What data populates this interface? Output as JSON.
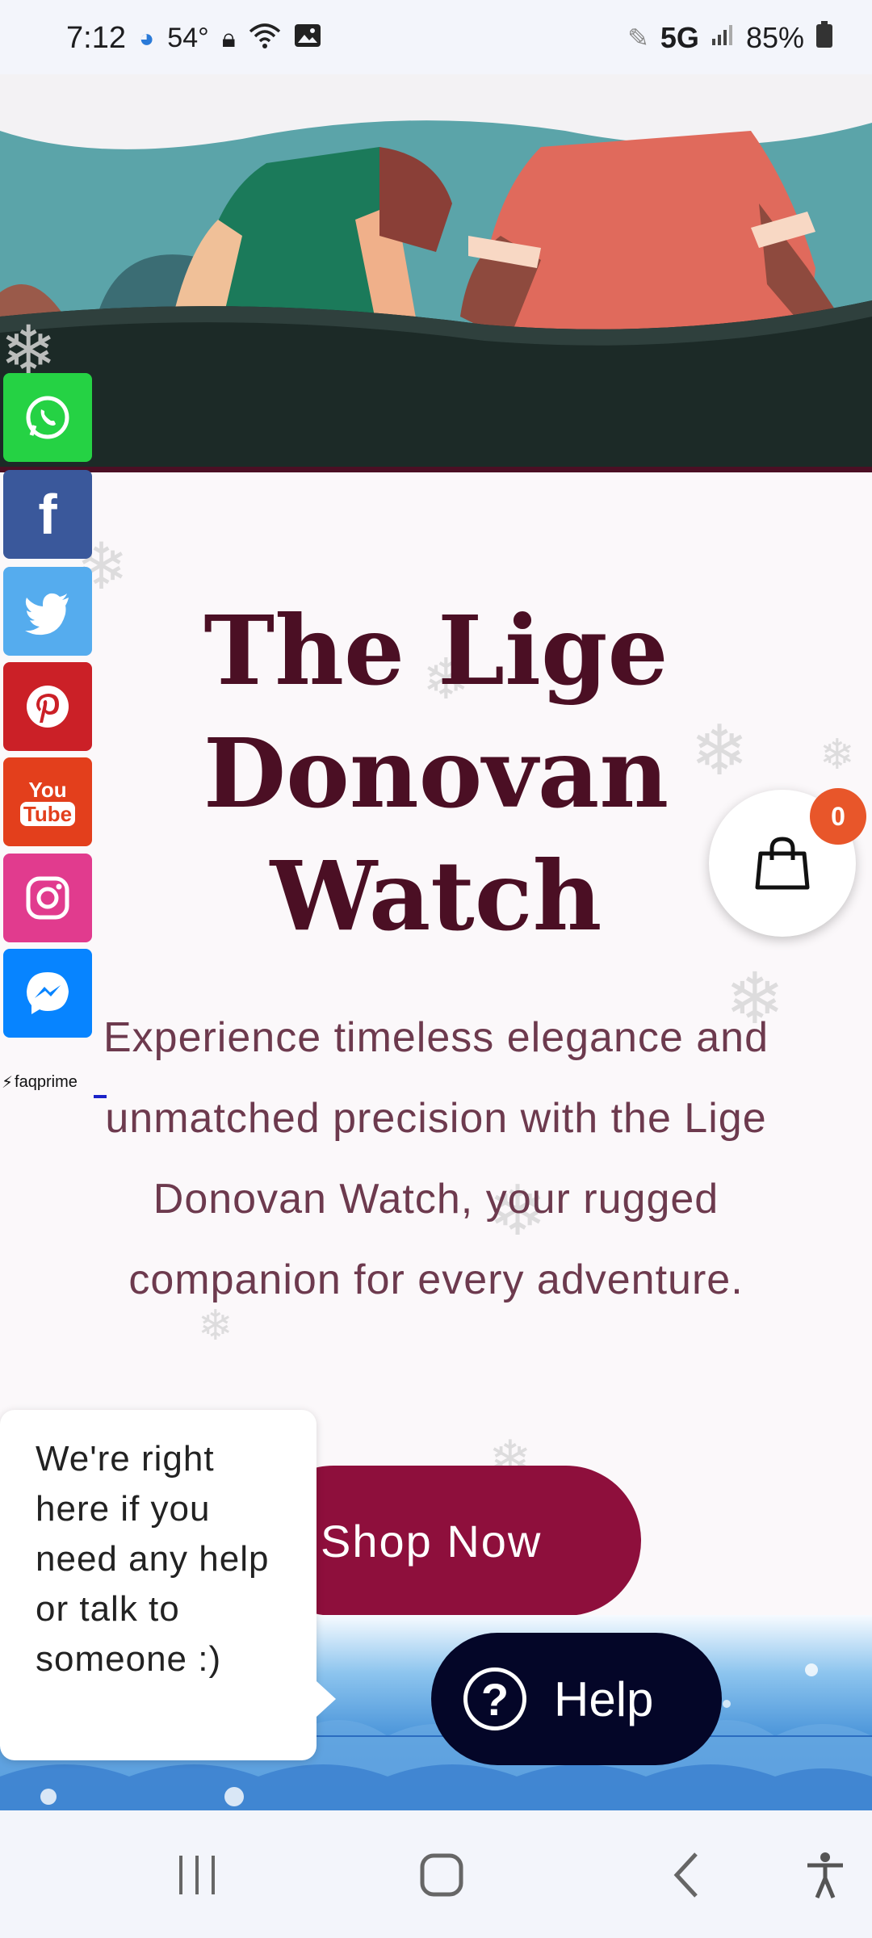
{
  "status_bar": {
    "time": "7:12",
    "temp": "54°",
    "network": "5G",
    "battery": "85%"
  },
  "social_links": [
    {
      "name": "whatsapp",
      "color": "#25d244"
    },
    {
      "name": "facebook",
      "color": "#3a589b"
    },
    {
      "name": "twitter",
      "color": "#55acee"
    },
    {
      "name": "pinterest",
      "color": "#cb2027"
    },
    {
      "name": "youtube",
      "color": "#e33f1c"
    },
    {
      "name": "instagram",
      "color": "#e13b8e"
    },
    {
      "name": "messenger",
      "color": "#0784ff"
    }
  ],
  "youtube_label_top": "You",
  "youtube_label_bottom": "Tube",
  "faqprime_label": "faqprime",
  "product": {
    "title": "The Lige Donovan Watch",
    "description": "Experience timeless elegance and unmatched precision with the Lige Donovan Watch, your rugged companion for every adventure.",
    "cta": "Shop Now"
  },
  "cart": {
    "count": "0"
  },
  "chat": {
    "message": "We're right here if you need any help or talk to someone :)",
    "help_label": "Help",
    "help_icon": "?"
  },
  "colors": {
    "title": "#4b0f24",
    "button": "#8e0f3c",
    "help_button": "#040628",
    "cart_badge": "#e8562a"
  }
}
